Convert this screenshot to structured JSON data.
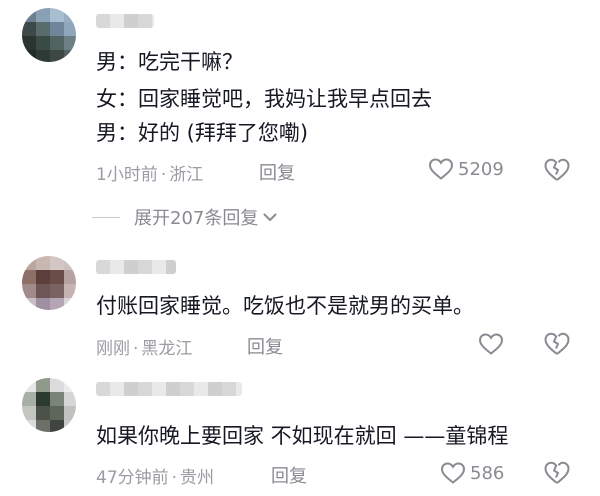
{
  "comments": [
    {
      "lines": [
        "男：吃完干嘛？",
        "女：回家睡觉吧，我妈让我早点回去",
        "男：好的 (拜拜了您嘞)"
      ],
      "time": "1小时前",
      "location": "浙江",
      "reply_label": "回复",
      "likes": "5209",
      "expand_label": "展开207条回复"
    },
    {
      "lines": [
        "付账回家睡觉。吃饭也不是就男的买单。"
      ],
      "time": "刚刚",
      "location": "黑龙江",
      "reply_label": "回复",
      "likes": ""
    },
    {
      "lines": [
        "如果你晚上要回家 不如现在就回 ——童锦程"
      ],
      "time": "47分钟前",
      "location": "贵州",
      "reply_label": "回复",
      "likes": "586"
    }
  ],
  "separator": "·",
  "icons": {
    "like": "heart-outline-icon",
    "dislike": "broken-heart-icon",
    "expand": "chevron-down-icon"
  },
  "colors": {
    "text": "#161823",
    "meta": "#9b9ba3",
    "icon": "#8a8a92"
  }
}
